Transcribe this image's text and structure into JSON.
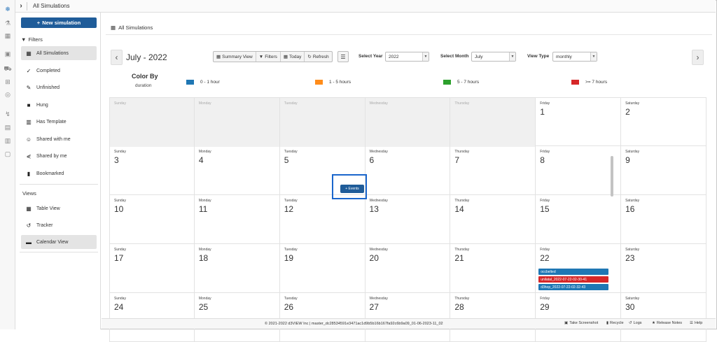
{
  "topbar": {
    "title": "All Simulations"
  },
  "rail": [
    "snowflake-icon",
    "flask-icon",
    "grid-icon",
    "monitor-icon",
    "car-icon",
    "bus-icon",
    "database-icon",
    "chart-icon",
    "clipboard-icon",
    "columns-icon",
    "document-icon"
  ],
  "left": {
    "new_sim": "New simulation",
    "filters_label": "Filters",
    "filters": [
      {
        "label": "All Simulations",
        "icon": "table-icon",
        "selected": true
      },
      {
        "label": "Completed",
        "icon": "check-icon"
      },
      {
        "label": "Unfinished",
        "icon": "edit-icon"
      },
      {
        "label": "Hung",
        "icon": "stop-icon"
      },
      {
        "label": "Has Template",
        "icon": "template-icon"
      },
      {
        "label": "Shared with me",
        "icon": "users-icon"
      },
      {
        "label": "Shared by me",
        "icon": "share-icon"
      },
      {
        "label": "Bookmarked",
        "icon": "bookmark-icon"
      }
    ],
    "views_label": "Views",
    "views": [
      {
        "label": "Table View",
        "icon": "table-icon"
      },
      {
        "label": "Tracker",
        "icon": "history-icon"
      },
      {
        "label": "Calendar View",
        "icon": "calendar-icon",
        "selected": true
      }
    ]
  },
  "main": {
    "breadcrumb": "All Simulations",
    "month_title": "July - 2022",
    "buttons": [
      "Summary View",
      "Filters",
      "Today",
      "Refresh"
    ],
    "select_year_label": "Select Year",
    "select_year_value": "2022",
    "select_month_label": "Select Month",
    "select_month_value": "July",
    "view_type_label": "View Type",
    "view_type_value": "monthly",
    "color_by_title": "Color By",
    "color_by_value": "duration",
    "legend": [
      {
        "label": "0 - 1 hour",
        "color": "#1f77b4"
      },
      {
        "label": "1 - 5 hours",
        "color": "#ff8c1a"
      },
      {
        "label": "5 - 7 hours",
        "color": "#2ca02c"
      },
      {
        "label": ">= 7 hours",
        "color": "#d62728"
      }
    ],
    "add_events_label": "+ Events"
  },
  "calendar": {
    "weeks": [
      [
        {
          "dow": "Sunday",
          "empty": true
        },
        {
          "dow": "Monday",
          "empty": true
        },
        {
          "dow": "Tuesday",
          "empty": true
        },
        {
          "dow": "Wednesday",
          "empty": true
        },
        {
          "dow": "Thursday",
          "empty": true
        },
        {
          "dow": "Friday",
          "day": "1"
        },
        {
          "dow": "Saturday",
          "day": "2"
        }
      ],
      [
        {
          "dow": "Sunday",
          "day": "3"
        },
        {
          "dow": "Monday",
          "day": "4"
        },
        {
          "dow": "Tuesday",
          "day": "5"
        },
        {
          "dow": "Wednesday",
          "day": "6"
        },
        {
          "dow": "Thursday",
          "day": "7"
        },
        {
          "dow": "Friday",
          "day": "8"
        },
        {
          "dow": "Saturday",
          "day": "9"
        }
      ],
      [
        {
          "dow": "Sunday",
          "day": "10"
        },
        {
          "dow": "Monday",
          "day": "11"
        },
        {
          "dow": "Tuesday",
          "day": "12"
        },
        {
          "dow": "Wednesday",
          "day": "13"
        },
        {
          "dow": "Thursday",
          "day": "14"
        },
        {
          "dow": "Friday",
          "day": "15"
        },
        {
          "dow": "Saturday",
          "day": "16"
        }
      ],
      [
        {
          "dow": "Sunday",
          "day": "17"
        },
        {
          "dow": "Monday",
          "day": "18"
        },
        {
          "dow": "Tuesday",
          "day": "19"
        },
        {
          "dow": "Wednesday",
          "day": "20"
        },
        {
          "dow": "Thursday",
          "day": "21"
        },
        {
          "dow": "Friday",
          "day": "22",
          "events": [
            {
              "label": "occbelted",
              "color": "#1f77b4"
            },
            {
              "label": "unilatal_2022-07-22-02-30-41",
              "color": "#d62728"
            },
            {
              "label": "d3hop_2022-07-22-02-32-43",
              "color": "#1f77b4"
            }
          ]
        },
        {
          "dow": "Saturday",
          "day": "23"
        }
      ],
      [
        {
          "dow": "Sunday",
          "day": "24"
        },
        {
          "dow": "Monday",
          "day": "25"
        },
        {
          "dow": "Tuesday",
          "day": "26"
        },
        {
          "dow": "Wednesday",
          "day": "27"
        },
        {
          "dow": "Thursday",
          "day": "28"
        },
        {
          "dow": "Friday",
          "day": "29"
        },
        {
          "dow": "Saturday",
          "day": "30"
        }
      ]
    ]
  },
  "footer": {
    "copyright": "© 2021-2022 d3VIEW Inc | master_dc28534591e3471ac1d9b5b16b167fa92c6b9a09_01-06-2023-11_02",
    "actions": [
      "Take Screenshot",
      "Recycle",
      "Logs",
      "Release Notes",
      "Help"
    ]
  }
}
